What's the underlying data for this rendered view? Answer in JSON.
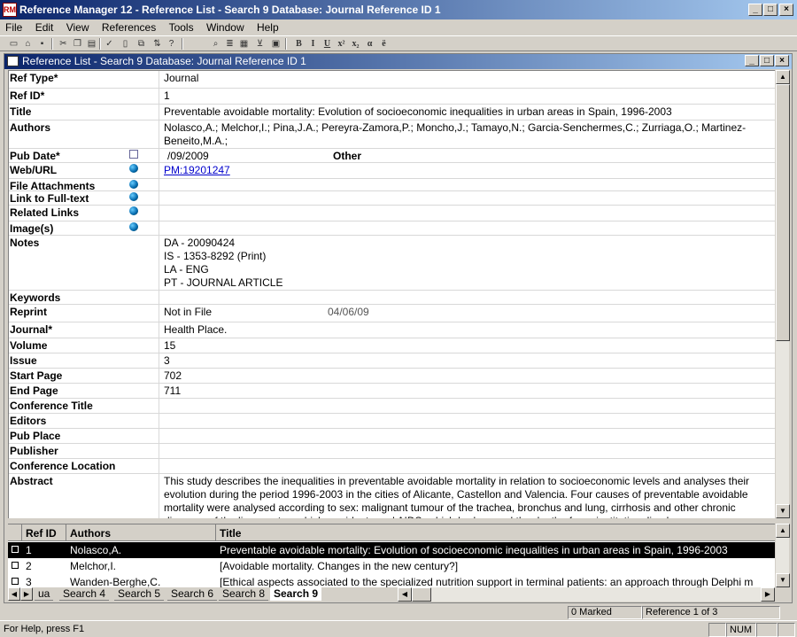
{
  "window": {
    "app_icon": "RM",
    "title": "Reference Manager 12 - Reference List - Search 9 Database: Journal Reference ID 1",
    "controls": [
      "_",
      "□",
      "×"
    ]
  },
  "menu": [
    "File",
    "Edit",
    "View",
    "References",
    "Tools",
    "Window",
    "Help"
  ],
  "toolbar": {
    "format_buttons": [
      "B",
      "I",
      "U",
      "x²",
      "x₂",
      "α",
      "ë"
    ]
  },
  "child_window": {
    "title": "Reference List - Search 9 Database: Journal Reference ID 1"
  },
  "form": {
    "ref_type": {
      "label": "Ref Type*",
      "value": "Journal"
    },
    "ref_id": {
      "label": "Ref ID*",
      "value": "1"
    },
    "title": {
      "label": "Title",
      "value": "Preventable avoidable mortality: Evolution of socioeconomic inequalities in urban areas in Spain, 1996-2003"
    },
    "authors": {
      "label": "Authors",
      "value": "Nolasco,A.; Melchor,I.; Pina,J.A.; Pereyra-Zamora,P.; Moncho,J.; Tamayo,N.; Garcia-Senchermes,C.; Zurriaga,O.; Martinez-Beneito,M.A.;"
    },
    "pub_date": {
      "label": "Pub Date*",
      "value": "/09/2009",
      "other_label": "Other"
    },
    "web_url": {
      "label": "Web/URL",
      "value": "PM:19201247"
    },
    "file_attachments": {
      "label": "File Attachments"
    },
    "link_full_text": {
      "label": "Link to Full-text"
    },
    "related_links": {
      "label": "Related Links"
    },
    "images": {
      "label": "Image(s)"
    },
    "notes": {
      "label": "Notes",
      "lines": [
        "DA - 20090424",
        "IS - 1353-8292 (Print)",
        "LA - ENG",
        "PT - JOURNAL ARTICLE"
      ]
    },
    "keywords": {
      "label": "Keywords"
    },
    "reprint": {
      "label": "Reprint",
      "value": "Not in File",
      "date": "04/06/09"
    },
    "journal": {
      "label": "Journal*",
      "value": "Health Place."
    },
    "volume": {
      "label": "Volume",
      "value": "15"
    },
    "issue": {
      "label": "Issue",
      "value": "3"
    },
    "start_page": {
      "label": "Start Page",
      "value": "702"
    },
    "end_page": {
      "label": "End Page",
      "value": "711"
    },
    "conference_title": {
      "label": "Conference Title"
    },
    "editors": {
      "label": "Editors"
    },
    "pub_place": {
      "label": "Pub Place"
    },
    "publisher": {
      "label": "Publisher"
    },
    "conference_location": {
      "label": "Conference Location"
    },
    "abstract": {
      "label": "Abstract",
      "value": "This study describes the inequalities in preventable avoidable mortality in relation to socioeconomic levels and analyses their evolution during the period 1996-2003 in the cities of Alicante, Castellon and Valencia. Four causes of preventable avoidable mortality were analysed according to sex: malignant tumour of the trachea, bronchus and lung, cirrhosis and other chronic diseases of the liver, motor vehicle accidents and AIDS, which had caused the death of non-institutionalised"
    }
  },
  "list": {
    "columns": [
      "Ref ID",
      "Authors",
      "Title"
    ],
    "rows": [
      {
        "id": "1",
        "author": "Nolasco,A.",
        "title": "Preventable avoidable mortality: Evolution of socioeconomic inequalities in urban areas in Spain, 1996-2003",
        "selected": true
      },
      {
        "id": "2",
        "author": "Melchor,I.",
        "title": "[Avoidable mortality. Changes in the new century?]",
        "selected": false
      },
      {
        "id": "3",
        "author": "Wanden-Berghe,C.",
        "title": "[Ethical aspects associated to the specialized nutrition support in terminal patients: an approach through Delphi m",
        "selected": false
      }
    ]
  },
  "tabs": [
    "ua",
    "Search 4",
    "Search 5",
    "Search 6",
    "Search 8",
    "Search 9"
  ],
  "active_tab": "Search 9",
  "child_status": {
    "marked": "0 Marked",
    "position": "Reference 1 of 3"
  },
  "statusbar": {
    "help": "For Help, press F1",
    "num": "NUM"
  },
  "colors": {
    "titlebar_start": "#0a246a",
    "titlebar_end": "#a6caf0",
    "link": "#0000cc",
    "selection": "#000000"
  }
}
